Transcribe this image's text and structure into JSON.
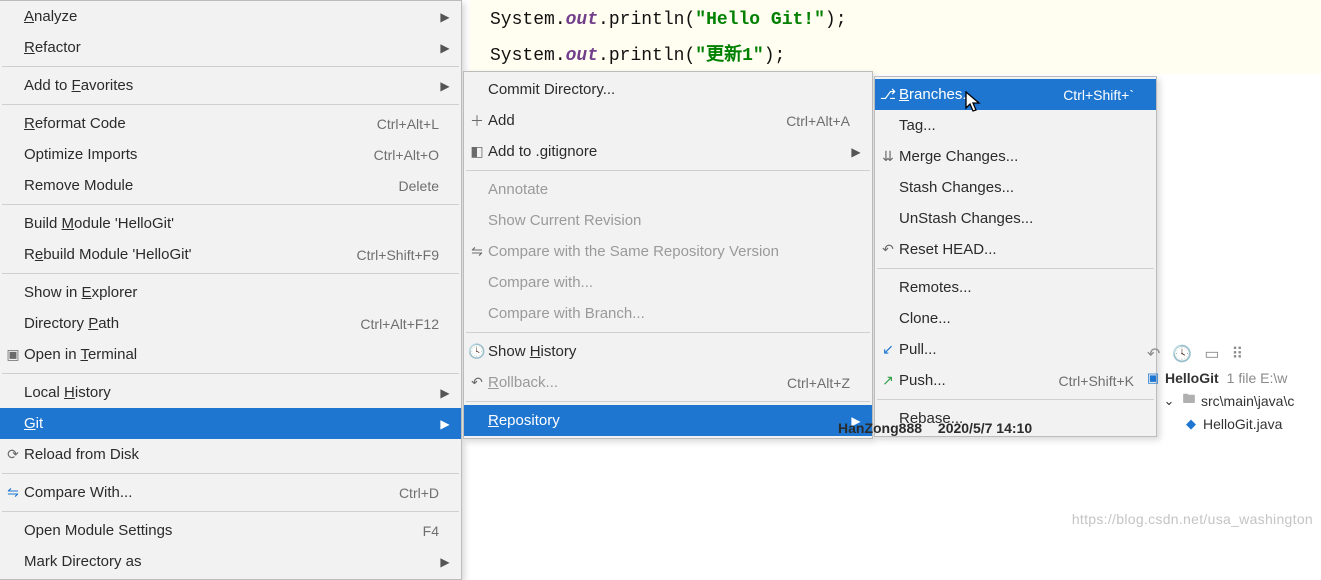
{
  "code": {
    "line1_sys": "System",
    "line1_out": "out",
    "line1_call": "println",
    "line1_str": "\"Hello Git!\"",
    "line2_sys": "System",
    "line2_out": "out",
    "line2_call": "println",
    "line2_str": "\"更新1\""
  },
  "menu1": {
    "analyze": "Analyze",
    "refactor": "Refactor",
    "add_fav": "Add to Favorites",
    "reformat": "Reformat Code",
    "reformat_sc": "Ctrl+Alt+L",
    "opt_imports": "Optimize Imports",
    "opt_imports_sc": "Ctrl+Alt+O",
    "remove_mod": "Remove Module",
    "remove_mod_sc": "Delete",
    "build_mod": "Build Module 'HelloGit'",
    "rebuild_mod": "Rebuild Module 'HelloGit'",
    "rebuild_mod_sc": "Ctrl+Shift+F9",
    "show_exp": "Show in Explorer",
    "dir_path": "Directory Path",
    "dir_path_sc": "Ctrl+Alt+F12",
    "open_term": "Open in Terminal",
    "local_hist": "Local History",
    "git": "Git",
    "reload": "Reload from Disk",
    "compare": "Compare With...",
    "compare_sc": "Ctrl+D",
    "open_mod_set": "Open Module Settings",
    "open_mod_set_sc": "F4",
    "mark_dir": "Mark Directory as"
  },
  "menu2": {
    "commit_dir": "Commit Directory...",
    "add": "Add",
    "add_sc": "Ctrl+Alt+A",
    "add_ign": "Add to .gitignore",
    "annotate": "Annotate",
    "show_rev": "Show Current Revision",
    "cmp_repo": "Compare with the Same Repository Version",
    "cmp_with": "Compare with...",
    "cmp_branch": "Compare with Branch...",
    "show_hist": "Show History",
    "rollback": "Rollback...",
    "rollback_sc": "Ctrl+Alt+Z",
    "repository": "Repository"
  },
  "menu3": {
    "branches": "Branches...",
    "branches_sc": "Ctrl+Shift+`",
    "tag": "Tag...",
    "merge": "Merge Changes...",
    "stash": "Stash Changes...",
    "unstash": "UnStash Changes...",
    "reset": "Reset HEAD...",
    "remotes": "Remotes...",
    "clone": "Clone...",
    "pull": "Pull...",
    "push": "Push...",
    "push_sc": "Ctrl+Shift+K",
    "rebase": "Rebase..."
  },
  "annotation": {
    "author": "HanZong888",
    "date": "2020/5/7 14:10"
  },
  "tree": {
    "root": "HelloGit",
    "root_meta": "1 file  E:\\w",
    "folder": "src\\main\\java\\c",
    "file": "HelloGit.java"
  },
  "watermark": "https://blog.csdn.net/usa_washington"
}
